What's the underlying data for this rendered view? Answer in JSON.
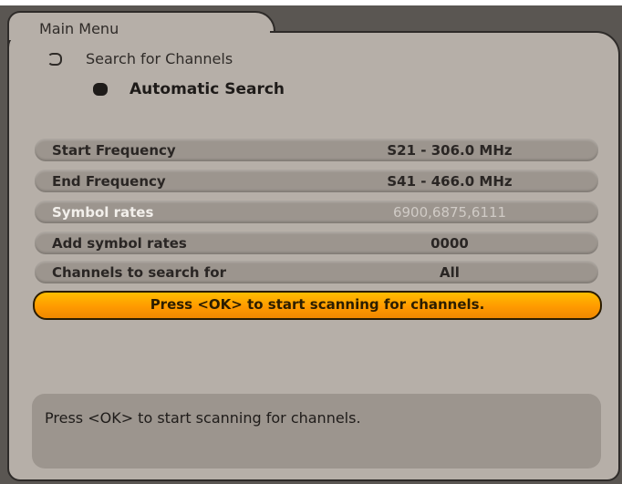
{
  "header": {
    "title": "Main Menu",
    "breadcrumb": [
      "Search for Channels",
      "Automatic Search"
    ]
  },
  "settings": [
    {
      "label": "Start Frequency",
      "value": "S21 - 306.0 MHz"
    },
    {
      "label": "End Frequency",
      "value": "S41 - 466.0 MHz"
    },
    {
      "label": "Symbol rates",
      "value": "6900,6875,6111"
    },
    {
      "label": "Add symbol rates",
      "value": "0000"
    },
    {
      "label": "Channels to search for",
      "value": "All"
    }
  ],
  "action": {
    "label": "Press <OK> to start scanning for channels."
  },
  "help": {
    "text": "Press <OK> to start scanning for channels."
  },
  "colors": {
    "accent": "#ff9a00",
    "panel": "#b6afa8",
    "row": "#9c958e"
  },
  "icons": {
    "breadcrumb": "arrow-icon"
  }
}
